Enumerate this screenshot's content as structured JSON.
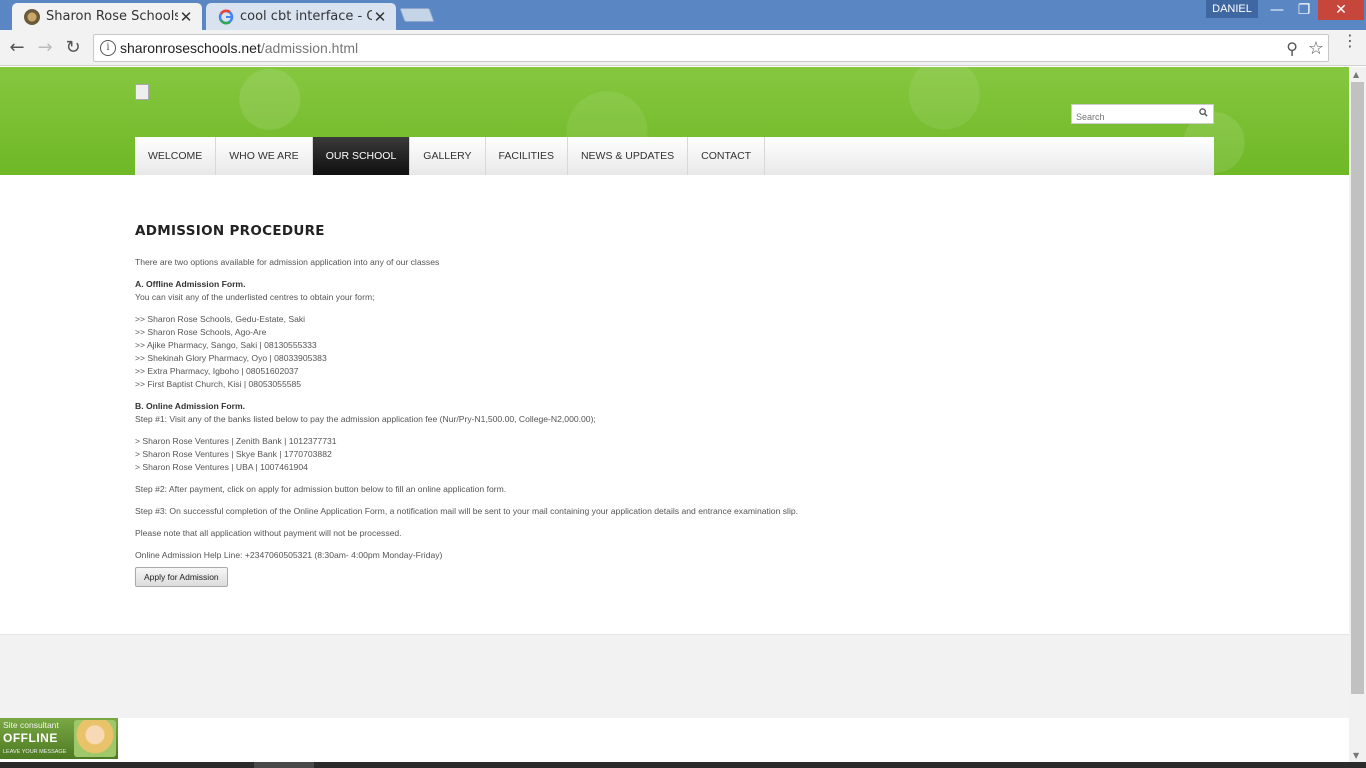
{
  "browser": {
    "tabs": [
      {
        "title": "Sharon Rose Schools | Ac",
        "active": true
      },
      {
        "title": "cool cbt interface - Goog",
        "active": false
      }
    ],
    "profile_name": "DANIEL",
    "url_domain": "sharonroseschools.net",
    "url_path": "/admission.html",
    "buttons": {
      "back": "←",
      "forward": "→",
      "reload": "↻",
      "minimize": "—",
      "restore": "❐",
      "close": "✕"
    },
    "icons": {
      "info": "i",
      "zoom": "⚲",
      "star": "☆",
      "menu": "⋮",
      "tab_close": "✕"
    }
  },
  "header": {
    "search_placeholder": "Search"
  },
  "nav": {
    "items": [
      "WELCOME",
      "WHO WE ARE",
      "OUR SCHOOL",
      "GALLERY",
      "FACILITIES",
      "NEWS & UPDATES",
      "CONTACT"
    ],
    "active": "OUR SCHOOL"
  },
  "content": {
    "heading": "ADMISSION PROCEDURE",
    "intro": "There are two options available for admission application into any of our classes",
    "offline_title": "A. Offline Admission Form.",
    "offline_desc": "You can visit any of the underlisted centres to obtain your form;",
    "centres": [
      ">> Sharon Rose Schools, Gedu-Estate, Saki",
      ">> Sharon Rose Schools, Ago-Are",
      ">> Ajike Pharmacy, Sango, Saki | 08130555333",
      ">> Shekinah Glory Pharmacy, Oyo | 08033905383",
      ">> Extra Pharmacy, Igboho | 08051602037",
      ">> First Baptist Church, Kisi | 08053055585"
    ],
    "online_title": "B. Online Admission Form.",
    "step1": "Step #1: Visit any of the banks listed below to pay the admission application fee (Nur/Pry-N1,500.00, College-N2,000.00);",
    "banks": [
      "> Sharon Rose Ventures | Zenith Bank | 1012377731",
      "> Sharon Rose Ventures | Skye Bank | 1770703882",
      "> Sharon Rose Ventures | UBA | 1007461904"
    ],
    "step2": "Step #2: After payment, click on apply for admission button below to fill an online application form.",
    "step3": "Step #3: On successful completion of the Online Application Form, a notification mail will be sent to your mail containing your application details and entrance examination slip.",
    "note": "Please note that all application without payment will not be processed.",
    "helpline": "Online Admission Help Line: +2347060505321 (8:30am- 4:00pm Monday-Friday)",
    "apply_button": "Apply for Admission"
  },
  "chat_widget": {
    "line1": "Site consultant",
    "line2": "OFFLINE",
    "line3": "LEAVE YOUR MESSAGE"
  },
  "colors": {
    "header_green": "#7dc035",
    "nav_active_bg": "#1a1a1a",
    "titlebar_blue": "#5a86c3"
  }
}
